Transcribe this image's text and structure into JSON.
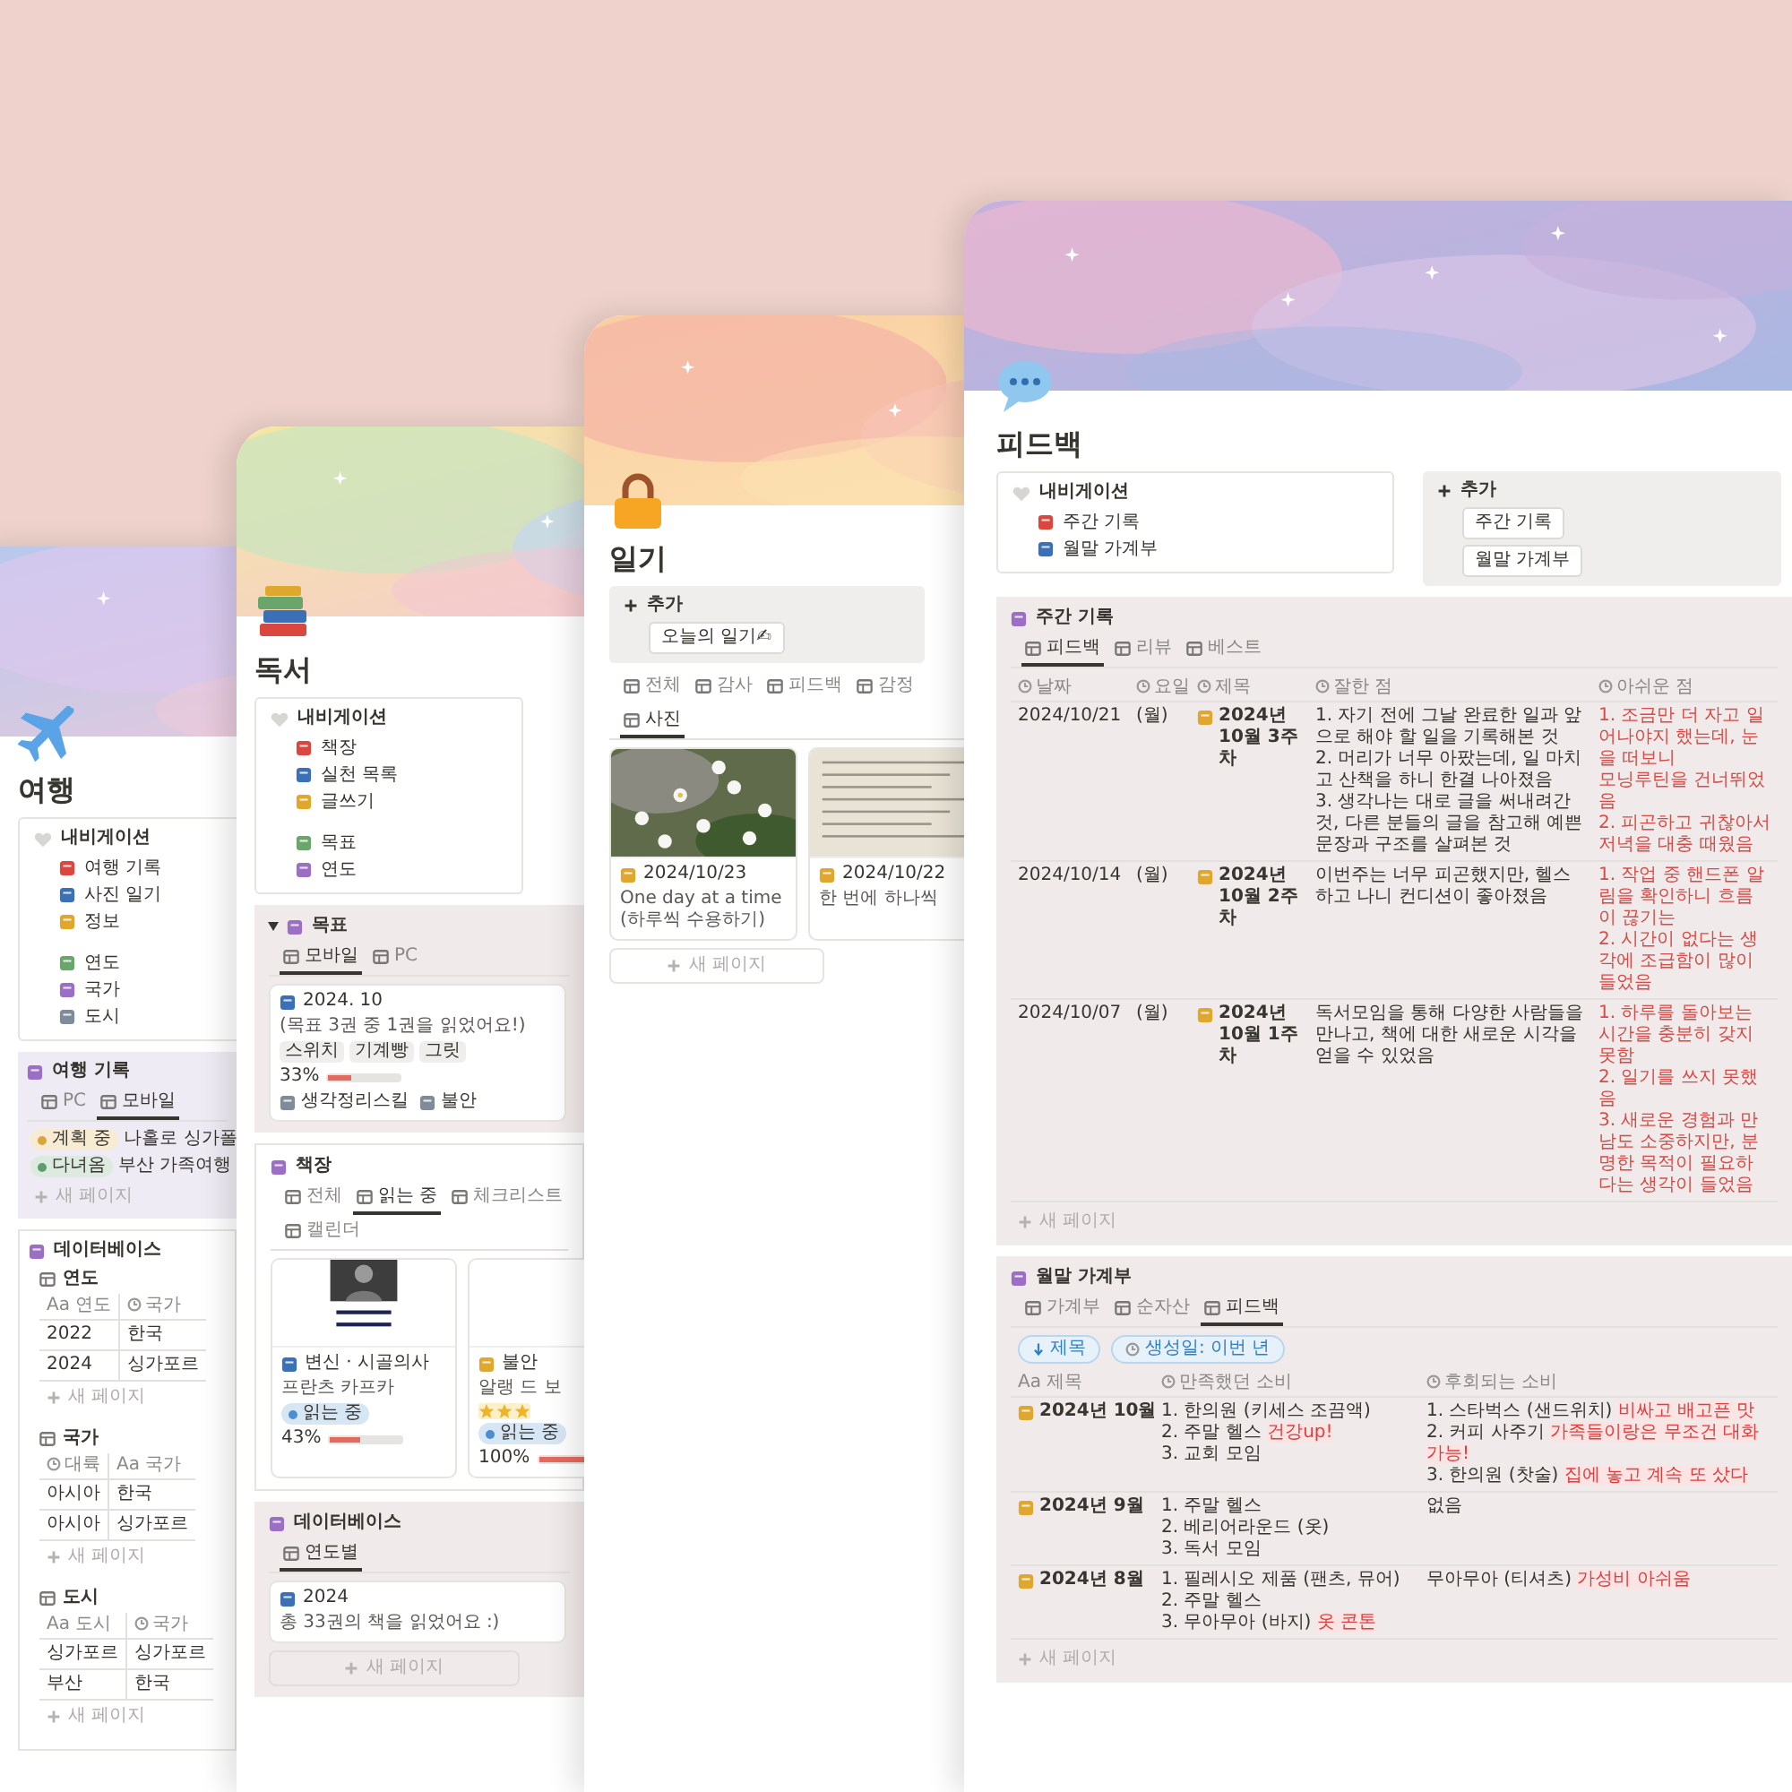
{
  "windows": [
    {
      "title": "여행",
      "blocks": [
        {
          "kind": "nav",
          "heading": "내비게이션",
          "groups": [
            [
              {
                "label": "여행 기록"
              },
              {
                "label": "사진 일기"
              },
              {
                "label": "정보"
              }
            ],
            [
              {
                "label": "연도"
              },
              {
                "label": "국가"
              },
              {
                "label": "도시"
              }
            ]
          ]
        },
        {
          "kind": "database",
          "heading": "여행 기록",
          "tabs": [
            {
              "label": "PC",
              "selected": false
            },
            {
              "label": "모바일",
              "selected": true
            }
          ],
          "view": {
            "kind": "list",
            "items": [
              {
                "tag": {
                  "label": "계획 중",
                  "color": "#d9a53c"
                },
                "title": "나홀로 싱가폴"
              },
              {
                "tag": {
                  "label": "다녀옴",
                  "color": "#5e9e6e"
                },
                "title": "부산 가족여행"
              }
            ]
          },
          "new_page": "새 페이지"
        },
        {
          "kind": "database",
          "heading": "데이터베이스",
          "view": {
            "kind": "sections",
            "sections": [
              {
                "title": "연도",
                "columns": [
                  {
                    "label": "Aa 연도",
                    "kind": "name"
                  },
                  {
                    "label": "국가",
                    "kind": "plain"
                  }
                ],
                "rows": [
                  [
                    "2022",
                    "한국"
                  ],
                  [
                    "2024",
                    "싱가포르"
                  ]
                ],
                "new_page": "새 페이지"
              },
              {
                "title": "국가",
                "columns": [
                  {
                    "label": "대륙",
                    "kind": "plain"
                  },
                  {
                    "label": "Aa 국가",
                    "kind": "name"
                  }
                ],
                "rows": [
                  [
                    "아시아",
                    "한국"
                  ],
                  [
                    "아시아",
                    "싱가포르"
                  ]
                ],
                "new_page": "새 페이지"
              },
              {
                "title": "도시",
                "columns": [
                  {
                    "label": "Aa 도시",
                    "kind": "name"
                  },
                  {
                    "label": "국가",
                    "kind": "plain"
                  }
                ],
                "rows": [
                  [
                    "싱가포르",
                    "싱가포르"
                  ],
                  [
                    "부산",
                    "한국"
                  ]
                ],
                "new_page": "새 페이지"
              }
            ]
          }
        }
      ]
    },
    {
      "title": "독서",
      "blocks": [
        {
          "kind": "nav",
          "heading": "내비게이션",
          "groups": [
            [
              {
                "label": "책장"
              },
              {
                "label": "실천 목록"
              },
              {
                "label": "글쓰기"
              }
            ],
            [
              {
                "label": "목표"
              },
              {
                "label": "연도"
              }
            ]
          ]
        },
        {
          "kind": "database",
          "expanded": true,
          "heading": "목표",
          "tabs": [
            {
              "label": "모바일",
              "selected": true
            },
            {
              "label": "PC",
              "selected": false
            }
          ],
          "view": {
            "kind": "cards",
            "cards": [
              {
                "kind": "none",
                "title": "2024. 10",
                "subtitle": "(목표 3권 중 1권을 읽었어요!)",
                "tags": [
                  "스위치",
                  "기계빵",
                  "그릿"
                ],
                "progress": {
                  "reading": "33%",
                  "level": 0.33
                },
                "links": [
                  "생각정리스킬",
                  "불안"
                ]
              }
            ]
          }
        },
        {
          "kind": "database",
          "heading": "책장",
          "tabs": [
            {
              "label": "전체",
              "selected": false
            },
            {
              "label": "읽는 중",
              "selected": true
            },
            {
              "label": "체크리스트",
              "selected": false
            },
            {
              "label": "캘린더",
              "selected": false
            }
          ],
          "view": {
            "kind": "cards",
            "cards": [
              {
                "kind": "picture",
                "title": "변신 · 시골의사",
                "subtitle": "프란츠 카프카",
                "status": {
                  "label": "읽는 중",
                  "color": "#4b8fd0"
                },
                "progress": {
                  "reading": "43%",
                  "level": 0.43
                }
              },
              {
                "kind": "blank",
                "title": "불안",
                "subtitle": "알랭 드 보",
                "stars": 3,
                "status": {
                  "label": "읽는 중",
                  "color": "#4b8fd0"
                },
                "progress": {
                  "reading": "100%",
                  "level": 1
                }
              }
            ]
          }
        },
        {
          "kind": "database",
          "heading": "데이터베이스",
          "tabs": [
            {
              "label": "연도별",
              "selected": true
            }
          ],
          "view": {
            "kind": "cards",
            "cards": [
              {
                "kind": "none",
                "title": "2024",
                "subtitle": "총 33권의 책을 읽었어요 :)"
              }
            ]
          },
          "new_page": "새 페이지"
        }
      ]
    },
    {
      "title": "일기",
      "blocks": [
        {
          "kind": "add",
          "heading": "추가",
          "buttons": [
            "오늘의 일기✍"
          ]
        },
        {
          "kind": "database",
          "tabs": [
            {
              "label": "전체",
              "selected": false
            },
            {
              "label": "감사",
              "selected": false
            },
            {
              "label": "피드백",
              "selected": false
            },
            {
              "label": "감정",
              "selected": false
            },
            {
              "label": "사진",
              "selected": true
            }
          ],
          "view": {
            "kind": "cards",
            "cards": [
              {
                "kind": "picture",
                "date": "2024/10/23",
                "subtitle": "One day at a time (하루씩 수용하기)"
              },
              {
                "kind": "picture",
                "date": "2024/10/22",
                "subtitle": "한 번에 하나씩"
              }
            ]
          },
          "new_page": "새 페이지"
        }
      ]
    },
    {
      "title": "피드백",
      "blocks": [
        {
          "kind": "columns",
          "blocks": [
            {
              "kind": "nav",
              "heading": "내비게이션",
              "groups": [
                [
                  {
                    "label": "주간 기록"
                  },
                  {
                    "label": "월말 가계부"
                  }
                ]
              ]
            },
            {
              "kind": "add",
              "heading": "추가",
              "buttons": [
                "주간 기록",
                "월말 가계부"
              ]
            }
          ]
        },
        {
          "kind": "database",
          "heading": "주간 기록",
          "tabs": [
            {
              "label": "피드백",
              "selected": true
            },
            {
              "label": "리뷰",
              "selected": false
            },
            {
              "label": "베스트",
              "selected": false
            }
          ],
          "view": {
            "kind": "table",
            "columns": [
              {
                "label": "날짜",
                "kind": "plain"
              },
              {
                "label": "요일",
                "kind": "plain"
              },
              {
                "label": "제목",
                "kind": "title"
              },
              {
                "label": "잘한 점",
                "kind": "plain"
              },
              {
                "label": "아쉬운 점",
                "kind": "warning"
              }
            ],
            "rows": [
              [
                "2024/10/21",
                "(월)",
                "2024년 10월 3주차",
                [
                  "1. 자기 전에 그날 완료한 일과 앞으로 해야 할 일을 기록해본 것",
                  "2. 머리가 너무 아팠는데, 일 마치고 산책을 하니 한결 나아졌음",
                  "3. 생각나는 대로 글을 써내려간 것, 다른 분들의 글을 참고해 예쁜 문장과 구조를 살펴본 것"
                ],
                [
                  "1. 조금만 더 자고 일어나야지 했는데, 눈을 떠보니",
                  "모닝루틴을 건너뛰었음",
                  "2. 피곤하고 귀찮아서 저녁을 대충 때웠음"
                ]
              ],
              [
                "2024/10/14",
                "(월)",
                "2024년 10월 2주차",
                "이번주는 너무 피곤했지만, 헬스하고 나니 컨디션이 좋아졌음",
                [
                  "1. 작업 중 핸드폰 알림을 확인하니 흐름이 끊기는",
                  "2. 시간이 없다는 생각에 조급함이 많이 들었음"
                ]
              ],
              [
                "2024/10/07",
                "(월)",
                "2024년 10월 1주차",
                "독서모임을 통해 다양한 사람들을 만나고, 책에 대한 새로운 시각을 얻을 수 있었음",
                [
                  "1. 하루를 돌아보는 시간을 충분히 갖지 못함",
                  "2. 일기를 쓰지 못했음",
                  "3. 새로운 경험과 만남도 소중하지만, 분명한 목적이 필요하다는 생각이 들었음"
                ]
              ]
            ]
          },
          "new_page": "새 페이지"
        },
        {
          "kind": "database",
          "heading": "월말 가계부",
          "tabs": [
            {
              "label": "가계부",
              "selected": false
            },
            {
              "label": "순자산",
              "selected": false
            },
            {
              "label": "피드백",
              "selected": true
            }
          ],
          "filters": [
            {
              "label": "제목"
            },
            {
              "label": "생성일: 이번 년"
            }
          ],
          "view": {
            "kind": "table",
            "columns": [
              {
                "label": "Aa 제목",
                "kind": "titled"
              },
              {
                "label": "만족했던 소비",
                "kind": "plain"
              },
              {
                "label": "후회되는 소비",
                "kind": "plain"
              }
            ],
            "rows": [
              [
                "2024년 10월",
                [
                  "1. 한의원 (키세스 조끔액)",
                  {
                    "text": "2. 주말 헬스",
                    "note": "건강up!"
                  },
                  "3. 교회 모임"
                ],
                [
                  {
                    "text": "1. 스타벅스 (샌드위치)",
                    "note": "비싸고 배고픈 맛"
                  },
                  {
                    "text": "2. 커피 사주기",
                    "note": "가족들이랑은 무조건 대화 가능!"
                  },
                  {
                    "text": "3. 한의원 (찻술)",
                    "note": "집에 놓고 계속 또 샀다"
                  }
                ]
              ],
              [
                "2024년 9월",
                [
                  "1. 주말 헬스",
                  "2. 베리어라운드 (옷)",
                  "3. 독서 모임"
                ],
                "없음"
              ],
              [
                "2024년 8월",
                [
                  "1. 필레시오 제품 (팬츠, 뮤어)",
                  "2. 주말 헬스",
                  {
                    "text": "3. 무아무아 (바지)",
                    "note": "옷 콘톤"
                  }
                ],
                [
                  {
                    "text": "무아무아 (티셔츠)",
                    "note": "가성비 아쉬움"
                  }
                ]
              ]
            ]
          },
          "new_page": "새 페이지"
        }
      ]
    }
  ]
}
